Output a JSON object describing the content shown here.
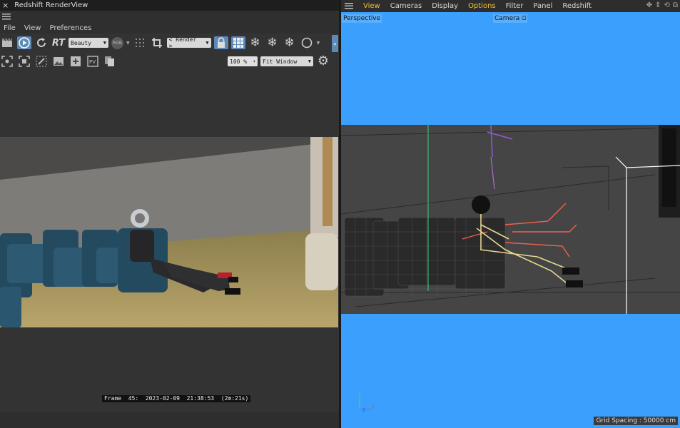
{
  "left": {
    "title": "Redshift RenderView",
    "close_glyph": "×",
    "menu": [
      "File",
      "View",
      "Preferences"
    ],
    "toolbar": {
      "aov_dropdown": "Beauty",
      "rgb_label": "RGB",
      "rt_label": "RT",
      "render_dropdown": "< Render >",
      "zoom_value": "100 %",
      "fit_dropdown": "Fit Window"
    },
    "status_text": "Frame  45:  2023-02-09  21:38:53  (2m:21s)"
  },
  "right": {
    "menu": [
      {
        "label": "View",
        "accent": true
      },
      {
        "label": "Cameras",
        "accent": false
      },
      {
        "label": "Display",
        "accent": false
      },
      {
        "label": "Options",
        "accent": true
      },
      {
        "label": "Filter",
        "accent": false
      },
      {
        "label": "Panel",
        "accent": false
      },
      {
        "label": "Redshift",
        "accent": false
      }
    ],
    "viewport_label": "Perspective",
    "camera_label": "Camera",
    "grid_spacing": "Grid Spacing : 50000 cm",
    "axis_labels": {
      "y": "Y",
      "x": "X",
      "z": "Z"
    }
  },
  "colors": {
    "accent_blue": "#3b9ffe",
    "menu_accent": "#f0c040",
    "selected_button": "#5b89b8"
  }
}
